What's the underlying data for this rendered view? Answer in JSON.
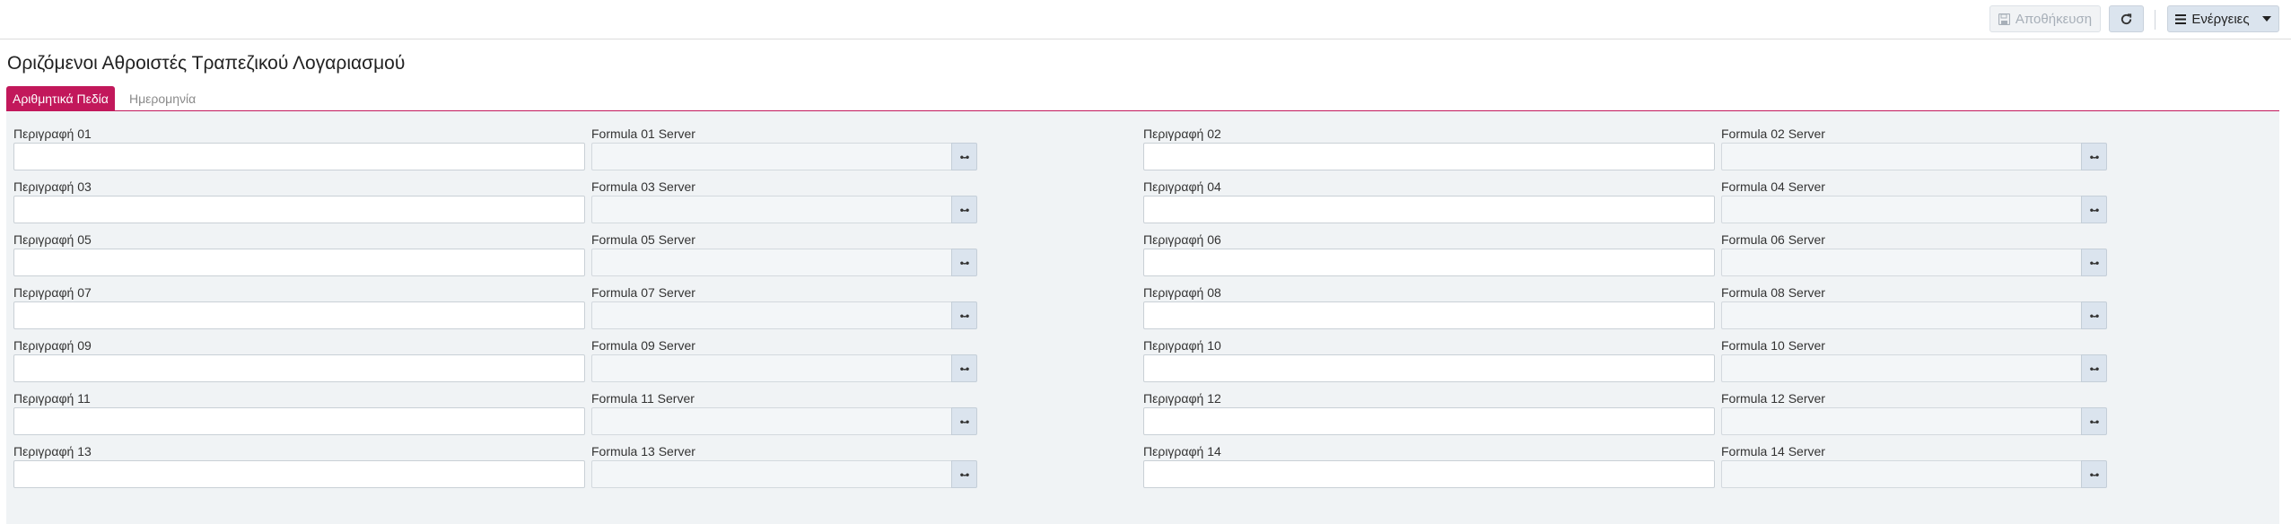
{
  "toolbar": {
    "save_label": "Αποθήκευση",
    "actions_label": "Ενέργειες",
    "icons": {
      "save": "floppy-icon",
      "refresh": "refresh-icon",
      "actions": "menu-icon",
      "caret": "caret-down-icon"
    }
  },
  "page": {
    "title": "Οριζόμενοι Αθροιστές Τραπεζικού Λογαριασμού"
  },
  "tabs": [
    {
      "label": "Αριθμητικά Πεδία",
      "active": true
    },
    {
      "label": "Ημερομηνία",
      "active": false
    }
  ],
  "rows": [
    {
      "left": {
        "label": "Περιγραφή 01",
        "formula_label": "Formula 01 Server"
      },
      "right": {
        "label": "Περιγραφή 02",
        "formula_label": "Formula 02 Server"
      }
    },
    {
      "left": {
        "label": "Περιγραφή 03",
        "formula_label": "Formula 03 Server"
      },
      "right": {
        "label": "Περιγραφή 04",
        "formula_label": "Formula 04 Server"
      }
    },
    {
      "left": {
        "label": "Περιγραφή 05",
        "formula_label": "Formula 05 Server"
      },
      "right": {
        "label": "Περιγραφή 06",
        "formula_label": "Formula 06 Server"
      }
    },
    {
      "left": {
        "label": "Περιγραφή 07",
        "formula_label": "Formula 07 Server"
      },
      "right": {
        "label": "Περιγραφή 08",
        "formula_label": "Formula 08 Server"
      }
    },
    {
      "left": {
        "label": "Περιγραφή 09",
        "formula_label": "Formula 09 Server"
      },
      "right": {
        "label": "Περιγραφή 10",
        "formula_label": "Formula 10 Server"
      }
    },
    {
      "left": {
        "label": "Περιγραφή 11",
        "formula_label": "Formula 11 Server"
      },
      "right": {
        "label": "Περιγραφή 12",
        "formula_label": "Formula 12 Server"
      }
    },
    {
      "left": {
        "label": "Περιγραφή 13",
        "formula_label": "Formula 13 Server"
      },
      "right": {
        "label": "Περιγραφή 14",
        "formula_label": "Formula 14 Server"
      }
    }
  ],
  "colors": {
    "accent": "#c2185b",
    "panel_bg": "#f0f3f5",
    "button_bg": "#dbe4ee"
  }
}
